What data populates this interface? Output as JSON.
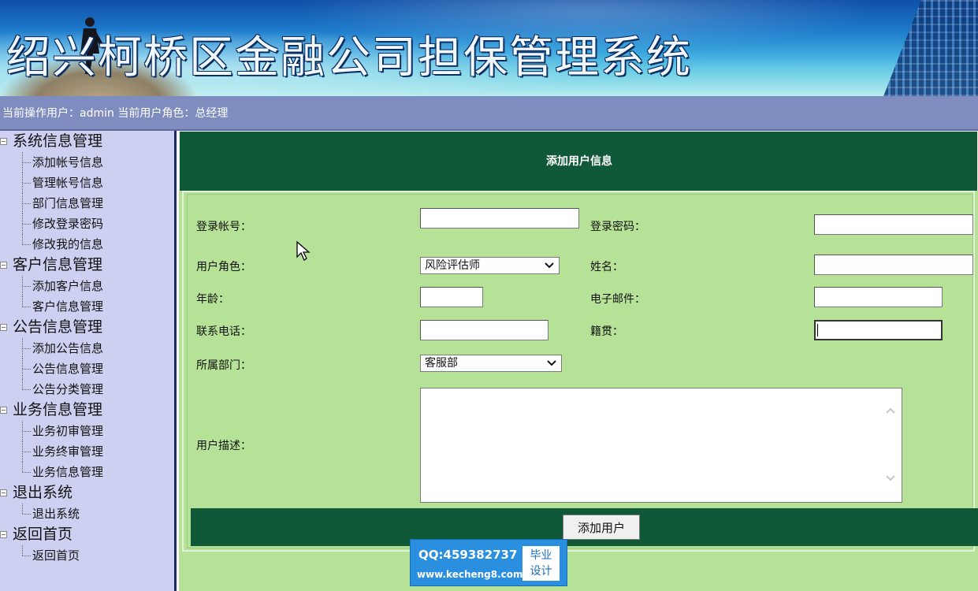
{
  "banner": {
    "title": "绍兴柯桥区金融公司担保管理系统"
  },
  "userbar": {
    "text": "当前操作用户：admin 当前用户角色：总经理"
  },
  "sidebar": {
    "groups": [
      {
        "title": "系统信息管理",
        "items": [
          "添加帐号信息",
          "管理帐号信息",
          "部门信息管理",
          "修改登录密码",
          "修改我的信息"
        ]
      },
      {
        "title": "客户信息管理",
        "items": [
          "添加客户信息",
          "客户信息管理"
        ]
      },
      {
        "title": "公告信息管理",
        "items": [
          "添加公告信息",
          "公告信息管理",
          "公告分类管理"
        ]
      },
      {
        "title": "业务信息管理",
        "items": [
          "业务初审管理",
          "业务终审管理",
          "业务信息管理"
        ]
      },
      {
        "title": "退出系统",
        "items": [
          "退出系统"
        ]
      },
      {
        "title": "返回首页",
        "items": [
          "返回首页"
        ]
      }
    ]
  },
  "form": {
    "header": "添加用户信息",
    "fields": {
      "account": {
        "label": "登录帐号：",
        "value": ""
      },
      "password": {
        "label": "登录密码：",
        "value": ""
      },
      "role": {
        "label": "用户角色：",
        "value": "风险评估师"
      },
      "name": {
        "label": "姓名：",
        "value": ""
      },
      "age": {
        "label": "年龄：",
        "value": ""
      },
      "email": {
        "label": "电子邮件：",
        "value": ""
      },
      "phone": {
        "label": "联系电话：",
        "value": ""
      },
      "hometown": {
        "label": "籍贯：",
        "value": ""
      },
      "department": {
        "label": "所属部门：",
        "value": "客服部"
      },
      "description": {
        "label": "用户描述：",
        "value": ""
      }
    },
    "submit_label": "添加用户"
  },
  "watermark": {
    "qq": "QQ:459382737",
    "site": "www.kecheng8.com",
    "tag_line1": "毕业",
    "tag_line2": "设计"
  },
  "colors": {
    "header_green": "#0f5838",
    "form_bg": "#b6e298",
    "sidebar_bg": "#cdd0f0",
    "userbar_bg": "#7f8cc0"
  }
}
